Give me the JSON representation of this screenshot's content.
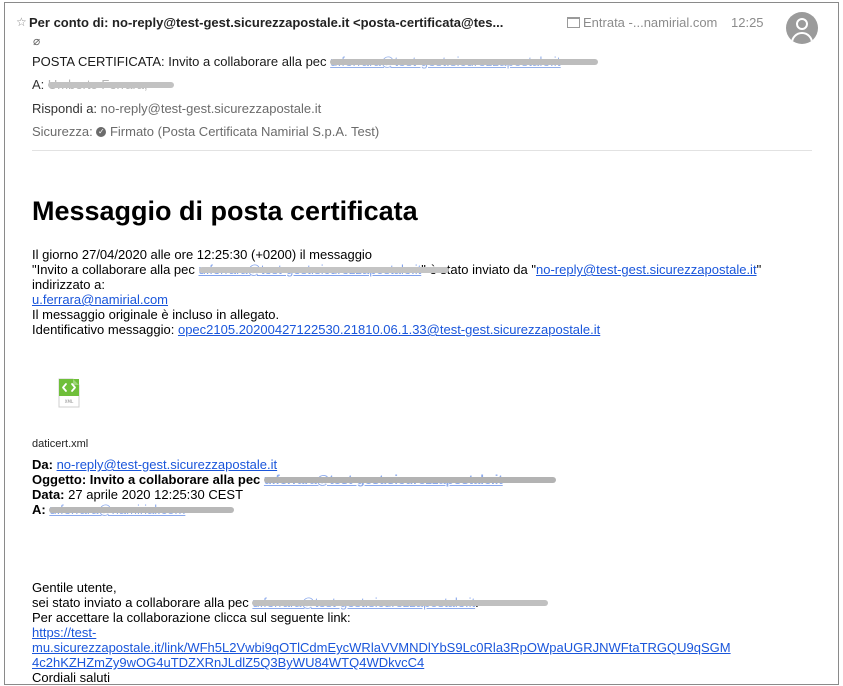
{
  "header": {
    "from": "Per conto di: no-reply@test-gest.sicurezzapostale.it <posta-certificata@tes...",
    "folder": "Entrata -...namirial.com",
    "time": "12:25",
    "subject_prefix": "POSTA CERTIFICATA: Invito a collaborare alla pec",
    "subject_redacted": "u.ferrara@test-gest.sicurezzapostale.it",
    "to_label": "A:",
    "to_value": "Umberto Ferrara;",
    "reply_label": "Rispondi a:",
    "reply_value": "no-reply@test-gest.sicurezzapostale.it",
    "security_label": "Sicurezza:",
    "security_value": "Firmato (Posta Certificata Namirial S.p.A. Test)"
  },
  "body": {
    "title": "Messaggio di posta certificata",
    "line1": "Il giorno 27/04/2020 alle ore 12:25:30 (+0200) il messaggio",
    "line2_prefix": "\"Invito a collaborare alla pec ",
    "line2_redacted": "u.ferrara@test-gest.sicurezzapostale.it",
    "line2_mid": "\" è stato inviato da \"",
    "line2_link": "no-reply@test-gest.sicurezzapostale.it",
    "line2_suffix": "\"",
    "line3": "indirizzato a:",
    "line4_link": "u.ferrara@namirial.com",
    "line5": "Il messaggio originale è incluso in allegato.",
    "line6_label": "Identificativo messaggio: ",
    "line6_link": "opec2105.20200427122530.21810.06.1.33@test-gest.sicurezzapostale.it",
    "attachment_name": "daticert.xml",
    "attachment_icon_text": "XML",
    "da_label": "Da:",
    "da_link": "no-reply@test-gest.sicurezzapostale.it",
    "oggetto_label": "Oggetto:",
    "oggetto_value": "Invito a collaborare alla pec",
    "oggetto_redacted": "u.ferrara@test-gest.sicurezzapostale.it",
    "data_label": "Data:",
    "data_value": "27 aprile 2020 12:25:30 CEST",
    "a_label": "A:",
    "a_redacted": "u.ferrara@namirial.com",
    "greeting": "Gentile utente,",
    "invite_prefix": "sei stato inviato a collaborare alla pec ",
    "invite_redacted": "u.ferrara@test-gest.sicurezzapostale.it",
    "invite_suffix": ".",
    "accept": "Per accettare la collaborazione clicca sul seguente link:",
    "link_line1": "https://test-",
    "link_line2": "mu.sicurezzapostale.it/link/WFh5L2Vwbi9qOTlCdmEycWRlaVVMNDlYbS9Lc0Rla3RpOWpaUGRJNWFtaTRGQU9qSGM",
    "link_line3": "4c2hKZHZmZy9wOG4uTDZXRnJLdlZ5Q3ByWU84WTQ4WDkvcC4",
    "closing": "Cordiali saluti"
  }
}
